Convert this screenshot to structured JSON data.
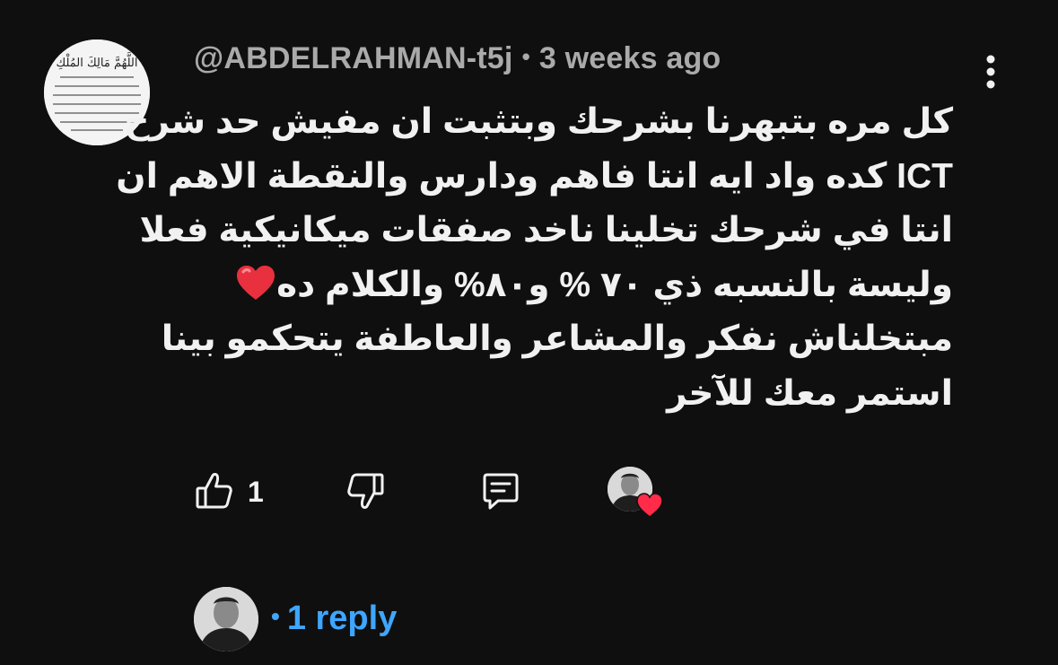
{
  "comment": {
    "author_handle": "@ABDELRAHMAN-t5j",
    "separator": "•",
    "timestamp": "3 weeks ago",
    "avatar_text": "اللَّهُمَّ مَالِكَ المُلْكِ",
    "lines": [
      "كل مره بتبهرنا بشرحك وبتثبت ان مفيش حد شرح",
      "ICT كده واد ايه انتا فاهم ودارس والنقطة الاهم ان",
      "انتا في شرحك تخلينا ناخد صفقات ميكانيكية  فعلا",
      "وليسة بالنسبه ذي ٧٠ % و٨٠% والكلام ده",
      "مبتخلناش نفكر والمشاعر والعاطفة يتحكمو بينا",
      "استمر معك للآخر"
    ],
    "emoji": "red-heart"
  },
  "actions": {
    "like_count": "1",
    "like_icon": "thumbs-up-icon",
    "dislike_icon": "thumbs-down-icon",
    "reply_icon": "comment-icon",
    "creator_heart_icon": "heart-icon",
    "heart_color": "#ff2b48"
  },
  "replies": {
    "separator": "•",
    "label": "1 reply",
    "link_color": "#3ea6ff"
  }
}
